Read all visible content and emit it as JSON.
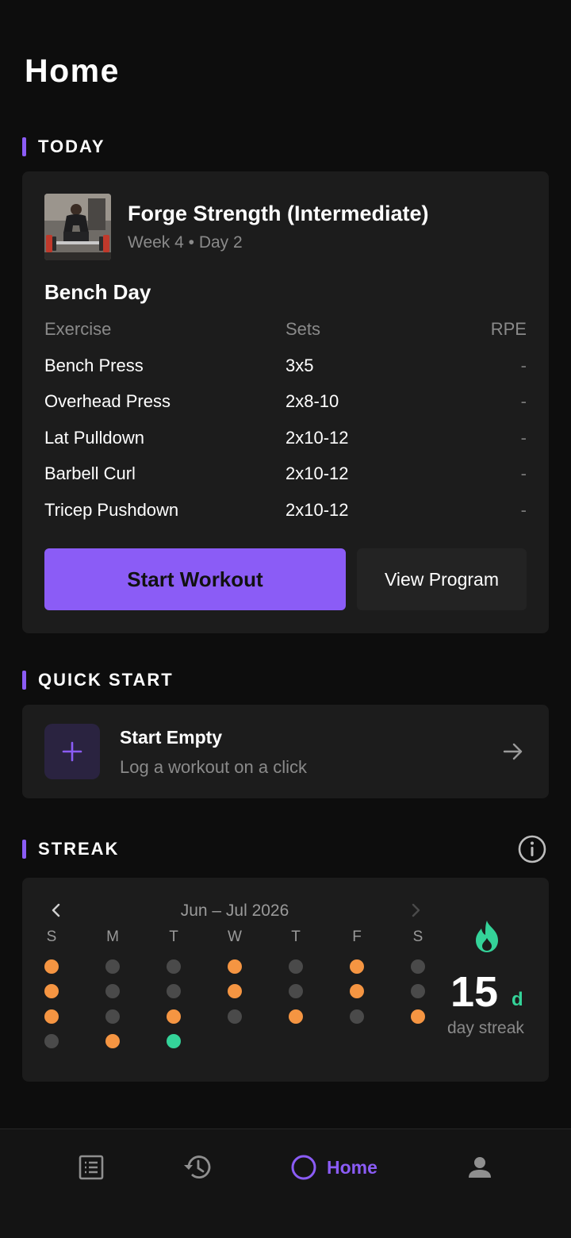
{
  "page": {
    "title": "Home"
  },
  "sections": {
    "today": "TODAY",
    "quick_start": "QUICK START",
    "streak": "STREAK"
  },
  "today": {
    "program_name": "Forge Strength (Intermediate)",
    "program_sub": "Week 4 • Day 2",
    "day_title": "Bench Day",
    "columns": [
      "Exercise",
      "Sets",
      "RPE"
    ],
    "exercises": [
      {
        "name": "Bench Press",
        "sets": "3x5",
        "rpe": "-"
      },
      {
        "name": "Overhead Press",
        "sets": "2x8-10",
        "rpe": "-"
      },
      {
        "name": "Lat Pulldown",
        "sets": "2x10-12",
        "rpe": "-"
      },
      {
        "name": "Barbell Curl",
        "sets": "2x10-12",
        "rpe": "-"
      },
      {
        "name": "Tricep Pushdown",
        "sets": "2x10-12",
        "rpe": "-"
      }
    ],
    "start_label": "Start Workout",
    "view_label": "View Program"
  },
  "quick_start": {
    "title": "Start Empty",
    "subtitle": "Log a workout on a click"
  },
  "streak": {
    "month_range": "Jun – Jul 2026",
    "weekdays": [
      "S",
      "M",
      "T",
      "W",
      "T",
      "F",
      "S"
    ],
    "weeks": [
      [
        "orange",
        "gray",
        "gray",
        "orange",
        "gray",
        "orange",
        "gray"
      ],
      [
        "orange",
        "gray",
        "gray",
        "orange",
        "gray",
        "orange",
        "gray"
      ],
      [
        "orange",
        "gray",
        "orange",
        "gray",
        "orange",
        "gray",
        "orange"
      ],
      [
        "gray",
        "orange",
        "green",
        null,
        null,
        null,
        null
      ]
    ],
    "count": "15",
    "unit": "d",
    "label": "day streak"
  },
  "colors": {
    "accent": "#8b5cf6",
    "active_day": "#f59542",
    "rest_day": "#4a4a4a",
    "today": "#34d399",
    "background": "#0d0d0d",
    "card": "#1c1c1c"
  },
  "nav": {
    "items": [
      {
        "icon": "list-icon"
      },
      {
        "icon": "history-icon"
      },
      {
        "icon": "home-circle-icon",
        "label": "Home"
      },
      {
        "icon": "profile-icon"
      }
    ]
  }
}
